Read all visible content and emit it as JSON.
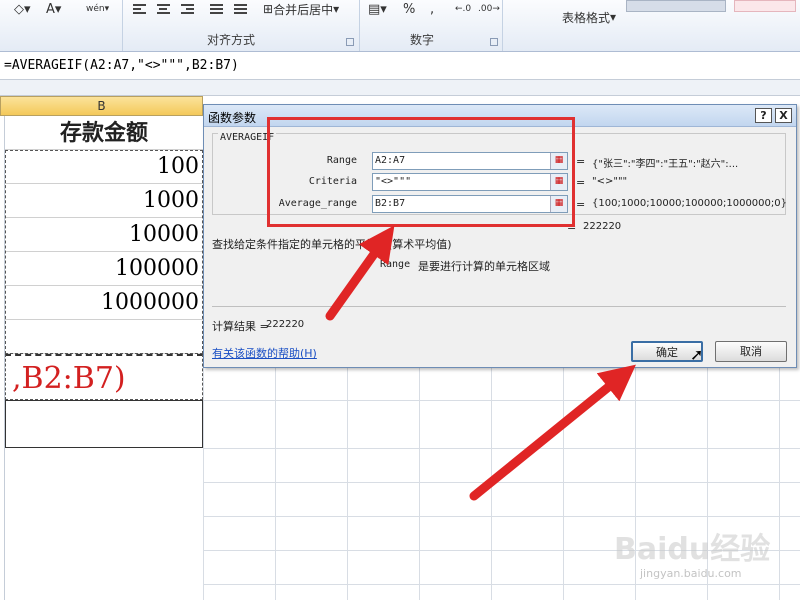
{
  "ribbon": {
    "alignment_group": "对齐方式",
    "number_group": "数字",
    "merge_center": "合并后居中",
    "percent": "%",
    "comma": ",",
    "table_format": "表格格式",
    "wen": "wén",
    "font_a": "A"
  },
  "formula_bar": {
    "formula": "=AVERAGEIF(A2:A7,\"<>\"\"\",B2:B7)"
  },
  "sheet": {
    "column_header": "B",
    "header_cell": "存款金额",
    "values": [
      "100",
      "1000",
      "10000",
      "100000",
      "1000000"
    ],
    "editing_text": ",B2:B7)"
  },
  "dialog": {
    "title": "函数参数",
    "help_btn": "?",
    "close_btn": "X",
    "function_name": "AVERAGEIF",
    "args": [
      {
        "label": "Range",
        "input": "A2:A7",
        "value": "{\"张三\":\"李四\":\"王五\":\"赵六\":..."
      },
      {
        "label": "Criteria",
        "input": "\"<>\"\"\"",
        "value": "\"<>\"\"\""
      },
      {
        "label": "Average_range",
        "input": "B2:B7",
        "value": "{100;1000;10000;100000;1000000;0}"
      }
    ],
    "total_value": "222220",
    "description": "查找给定条件指定的单元格的平均值(算术平均值)",
    "arg_help_name": "Range",
    "arg_help_text": "是要进行计算的单元格区域",
    "result_label": "计算结果 =",
    "result_value": "222220",
    "help_link": "有关该函数的帮助(H)",
    "ok": "确定",
    "cancel": "取消",
    "eq": "="
  },
  "watermark": {
    "logo": "Baidu经验",
    "url": "jingyan.baidu.com"
  },
  "colors": {
    "annotation": "#e03030",
    "selected_header": "#f4c95a",
    "link": "#1a4fc4"
  }
}
